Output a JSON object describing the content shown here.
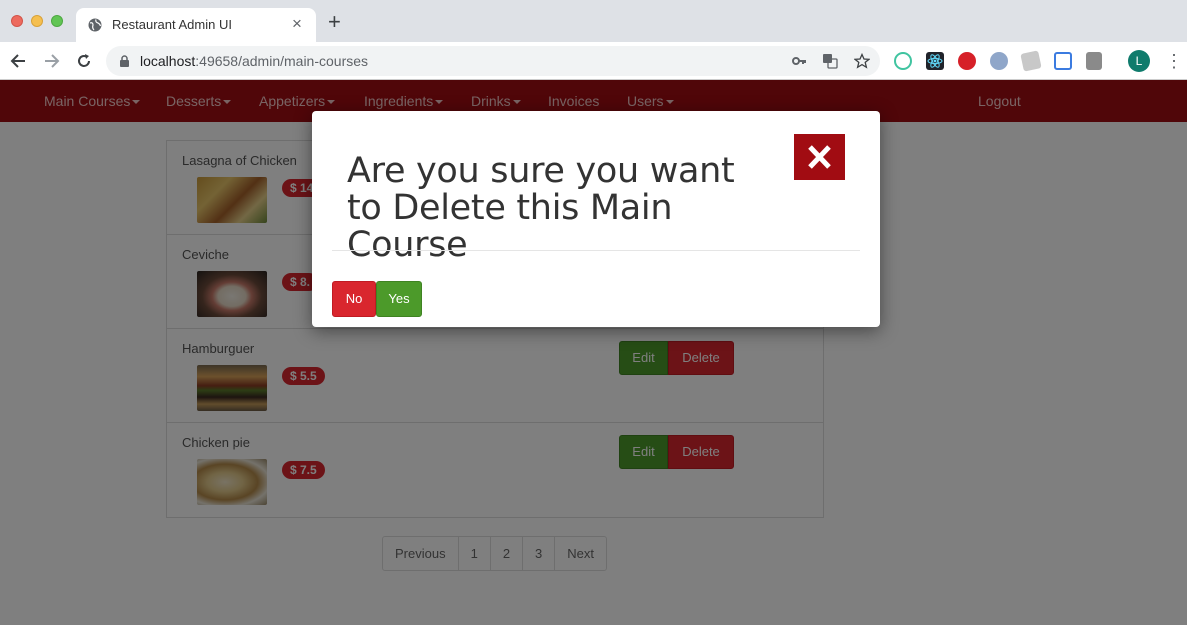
{
  "browser": {
    "tab_title": "Restaurant Admin UI",
    "url_host": "localhost",
    "url_rest": ":49658/admin/main-courses",
    "avatar_initial": "L"
  },
  "navbar": {
    "items": [
      "Main Courses",
      "Desserts",
      "Appetizers",
      "Ingredients",
      "Drinks",
      "Invoices",
      "Users"
    ],
    "logout": "Logout",
    "color": "#a10c12"
  },
  "list": {
    "rows": [
      {
        "name": "Lasagna of Chicken",
        "price": "$ 14"
      },
      {
        "name": "Ceviche",
        "price": "$ 8."
      },
      {
        "name": "Hamburguer",
        "price": "$ 5.5"
      },
      {
        "name": "Chicken pie",
        "price": "$ 7.5"
      }
    ],
    "edit_label": "Edit",
    "delete_label": "Delete"
  },
  "pagination": {
    "previous": "Previous",
    "pages": [
      "1",
      "2",
      "3"
    ],
    "next": "Next"
  },
  "modal": {
    "title": "Are you sure you want to Delete this Main Course",
    "no_label": "No",
    "yes_label": "Yes"
  },
  "colors": {
    "danger": "#d9262e",
    "success": "#4c9a2a"
  }
}
